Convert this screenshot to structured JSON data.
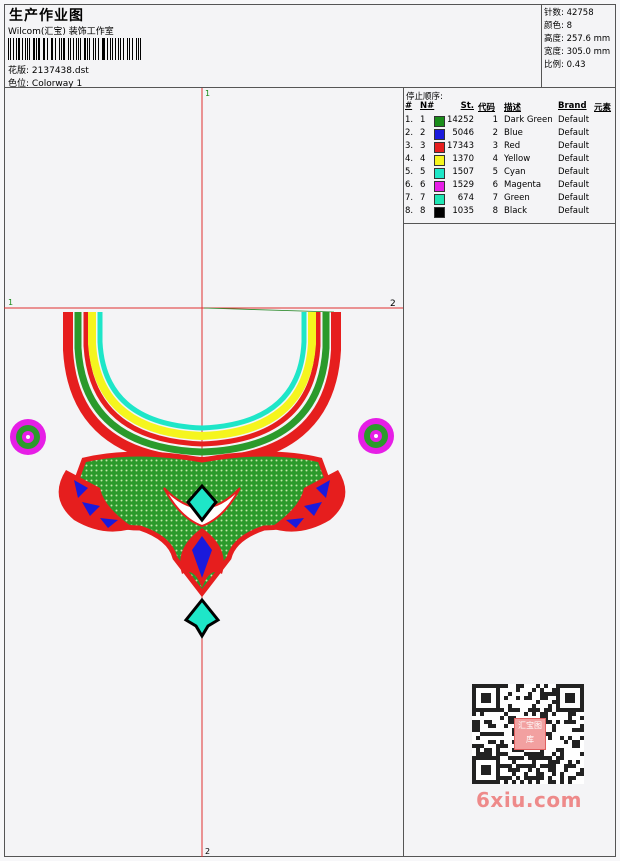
{
  "header": {
    "title": "生产作业图",
    "company": "Wilcom(汇宝) 装饰工作室",
    "design_label": "花版:",
    "design_value": "2137438.dst",
    "colorway_label": "色位:",
    "colorway_value": "Colorway 1"
  },
  "specs": [
    {
      "label": "针数:",
      "value": "42758"
    },
    {
      "label": "颜色:",
      "value": "8"
    },
    {
      "label": "高度:",
      "value": "257.6 mm"
    },
    {
      "label": "宽度:",
      "value": "305.0 mm"
    },
    {
      "label": "比例:",
      "value": "0.43"
    }
  ],
  "canvas": {
    "axis_top": "1",
    "axis_bottom": "2",
    "axis_left": "1",
    "axis_right": "2"
  },
  "stop_table": {
    "title": "停止顺序:",
    "headers": {
      "idx": "#",
      "no": "N#",
      "st": "St.",
      "code": "代码",
      "desc": "描述",
      "brand": "Brand",
      "elem": "元素"
    },
    "rows": [
      {
        "idx": "1.",
        "no": "1",
        "color": "#1a8c1a",
        "st": "14252",
        "code": "1",
        "desc": "Dark Green",
        "brand": "Default"
      },
      {
        "idx": "2.",
        "no": "2",
        "color": "#1a1adc",
        "st": "5046",
        "code": "2",
        "desc": "Blue",
        "brand": "Default"
      },
      {
        "idx": "3.",
        "no": "3",
        "color": "#e61e1e",
        "st": "17343",
        "code": "3",
        "desc": "Red",
        "brand": "Default"
      },
      {
        "idx": "4.",
        "no": "4",
        "color": "#f5f51e",
        "st": "1370",
        "code": "4",
        "desc": "Yellow",
        "brand": "Default"
      },
      {
        "idx": "5.",
        "no": "5",
        "color": "#1ee6c8",
        "st": "1507",
        "code": "5",
        "desc": "Cyan",
        "brand": "Default"
      },
      {
        "idx": "6.",
        "no": "6",
        "color": "#e61ee6",
        "st": "1529",
        "code": "6",
        "desc": "Magenta",
        "brand": "Default"
      },
      {
        "idx": "7.",
        "no": "7",
        "color": "#1ee6b4",
        "st": "674",
        "code": "7",
        "desc": "Green",
        "brand": "Default"
      },
      {
        "idx": "8.",
        "no": "8",
        "color": "#000000",
        "st": "1035",
        "code": "8",
        "desc": "Black",
        "brand": "Default"
      }
    ]
  },
  "watermark": {
    "qr_seal": "汇宝图库",
    "site": "6xiu.com"
  }
}
